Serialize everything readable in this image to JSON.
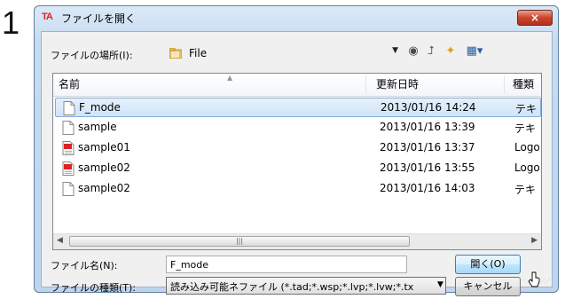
{
  "step_number": "1",
  "window": {
    "app_icon": "TA",
    "title": "ファイルを開く",
    "close_glyph": "×"
  },
  "location": {
    "label": "ファイルの場所(I):",
    "value": "File"
  },
  "toolbar": {
    "back_icon": "◉",
    "up_icon": "⮥",
    "new_folder_icon": "✦",
    "view_icon": "▦▾"
  },
  "columns": {
    "name": "名前",
    "date": "更新日時",
    "type": "種類"
  },
  "files": [
    {
      "name": "F_mode",
      "date": "2013/01/16 14:24",
      "type": "テキ",
      "icon": "text-file",
      "selected": true
    },
    {
      "name": "sample",
      "date": "2013/01/16 13:39",
      "type": "テキ",
      "icon": "text-file",
      "selected": false
    },
    {
      "name": "sample01",
      "date": "2013/01/16 13:37",
      "type": "Logo",
      "icon": "ta-file",
      "selected": false
    },
    {
      "name": "sample02",
      "date": "2013/01/16 13:55",
      "type": "Logo",
      "icon": "ta-file",
      "selected": false
    },
    {
      "name": "sample02",
      "date": "2013/01/16 14:03",
      "type": "テキ",
      "icon": "text-file",
      "selected": false
    }
  ],
  "filename": {
    "label": "ファイル名(N):",
    "value": "F_mode"
  },
  "filetype": {
    "label": "ファイルの種類(T):",
    "value": "読み込み可能ネファイル (*.tad;*.wsp;*.lvp;*.lvw;*.tx"
  },
  "buttons": {
    "open": "開く(O)",
    "cancel": "キャンセル"
  }
}
